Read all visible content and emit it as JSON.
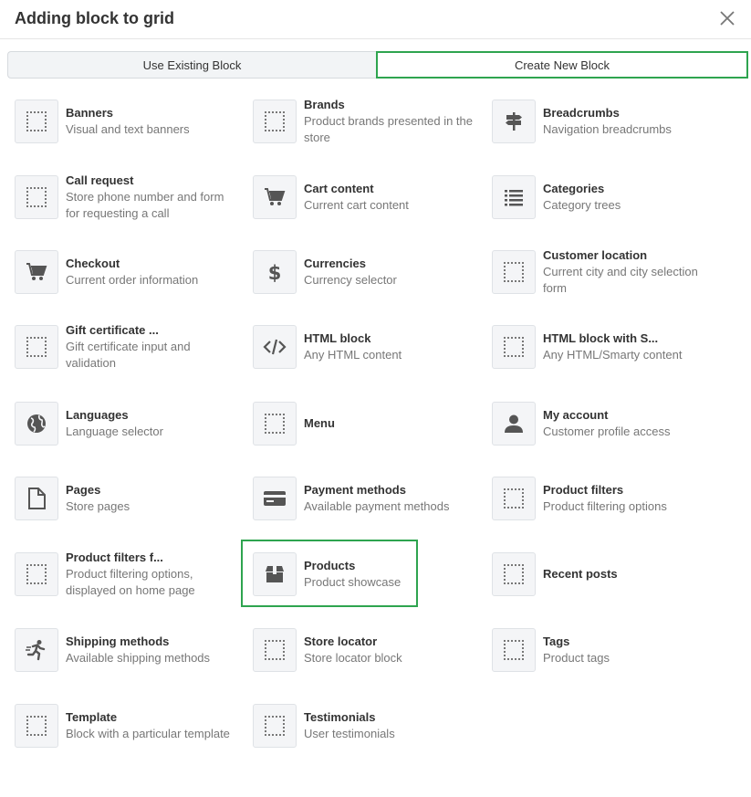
{
  "dialog": {
    "title": "Adding block to grid"
  },
  "tabs": {
    "existing": "Use Existing Block",
    "create": "Create New Block"
  },
  "blocks": [
    {
      "name": "Banners",
      "desc": "Visual and text banners",
      "icon": "placeholder-icon"
    },
    {
      "name": "Brands",
      "desc": "Product brands presented in the store",
      "icon": "placeholder-icon"
    },
    {
      "name": "Breadcrumbs",
      "desc": "Navigation breadcrumbs",
      "icon": "signpost-icon"
    },
    {
      "name": "Call request",
      "desc": "Store phone number and form for requesting a call",
      "icon": "placeholder-icon"
    },
    {
      "name": "Cart content",
      "desc": "Current cart content",
      "icon": "cart-icon"
    },
    {
      "name": "Categories",
      "desc": "Category trees",
      "icon": "list-icon"
    },
    {
      "name": "Checkout",
      "desc": "Current order information",
      "icon": "cart-icon"
    },
    {
      "name": "Currencies",
      "desc": "Currency selector",
      "icon": "dollar-icon"
    },
    {
      "name": "Customer location",
      "desc": "Current city and city selection form",
      "icon": "placeholder-icon"
    },
    {
      "name": "Gift certificate ...",
      "desc": "Gift certificate input and validation",
      "icon": "placeholder-icon"
    },
    {
      "name": "HTML block",
      "desc": "Any HTML content",
      "icon": "code-icon"
    },
    {
      "name": "HTML block with S...",
      "desc": "Any HTML/Smarty content",
      "icon": "placeholder-icon"
    },
    {
      "name": "Languages",
      "desc": "Language selector",
      "icon": "globe-icon"
    },
    {
      "name": "Menu",
      "desc": "",
      "icon": "placeholder-icon"
    },
    {
      "name": "My account",
      "desc": "Customer profile access",
      "icon": "user-icon"
    },
    {
      "name": "Pages",
      "desc": "Store pages",
      "icon": "page-icon"
    },
    {
      "name": "Payment methods",
      "desc": "Available payment methods",
      "icon": "credit-card-icon"
    },
    {
      "name": "Product filters",
      "desc": "Product filtering options",
      "icon": "placeholder-icon"
    },
    {
      "name": "Product filters f...",
      "desc": "Product filtering options, displayed on home page",
      "icon": "placeholder-icon"
    },
    {
      "name": "Products",
      "desc": "Product showcase",
      "icon": "box-icon"
    },
    {
      "name": "Recent posts",
      "desc": "",
      "icon": "placeholder-icon"
    },
    {
      "name": "Shipping methods",
      "desc": "Available shipping methods",
      "icon": "runner-icon"
    },
    {
      "name": "Store locator",
      "desc": "Store locator block",
      "icon": "placeholder-icon"
    },
    {
      "name": "Tags",
      "desc": "Product tags",
      "icon": "placeholder-icon"
    },
    {
      "name": "Template",
      "desc": "Block with a particular template",
      "icon": "placeholder-icon"
    },
    {
      "name": "Testimonials",
      "desc": "User testimonials",
      "icon": "placeholder-icon"
    }
  ],
  "colors": {
    "accent_green": "#2ea44f",
    "icon_gray": "#555555"
  }
}
